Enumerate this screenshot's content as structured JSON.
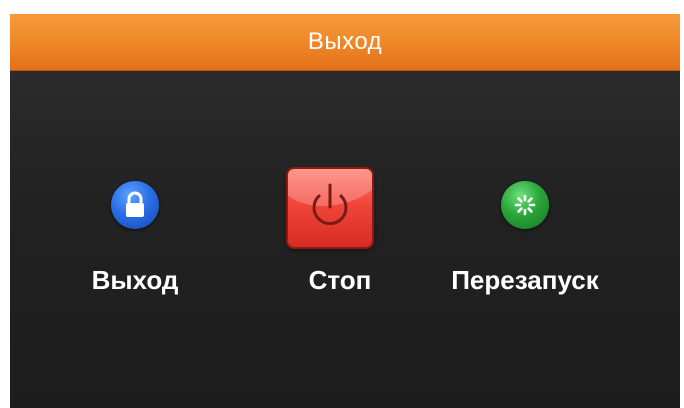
{
  "window": {
    "title": "Выход"
  },
  "options": [
    {
      "label": "Выход",
      "icon": "lock-icon",
      "color": "#2b6ee6"
    },
    {
      "label": "Стоп",
      "icon": "power-icon",
      "color": "#f1453a"
    },
    {
      "label": "Перезапуск",
      "icon": "restart-icon",
      "color": "#2aa63a"
    }
  ],
  "colors": {
    "accent": "#f08a2a",
    "background": "#1e1e1e"
  }
}
